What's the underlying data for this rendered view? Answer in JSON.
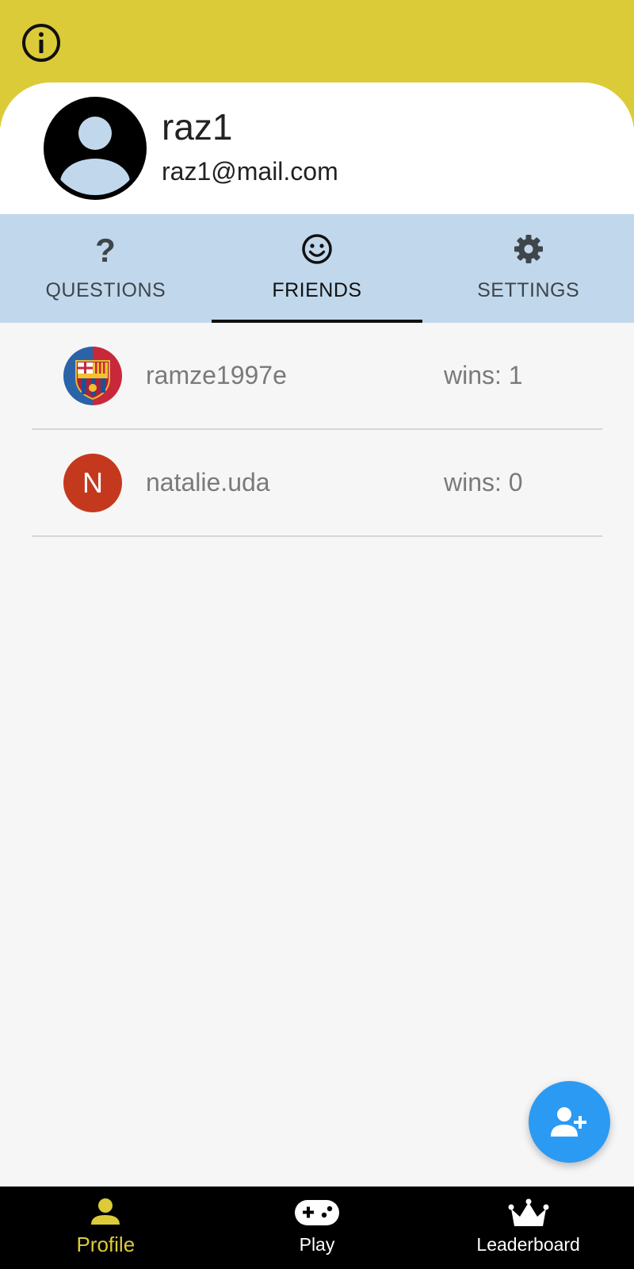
{
  "colors": {
    "accent_yellow": "#dccb39",
    "tab_background": "#c1d8ec",
    "fab_blue": "#2b9af3",
    "nav_background": "#000000"
  },
  "header": {
    "info_icon": "info-icon",
    "username": "raz1",
    "email": "raz1@mail.com"
  },
  "tabs": [
    {
      "label": "QUESTIONS",
      "icon": "question-mark-icon",
      "active": false
    },
    {
      "label": "FRIENDS",
      "icon": "smiley-face-icon",
      "active": true
    },
    {
      "label": "SETTINGS",
      "icon": "gear-icon",
      "active": false
    }
  ],
  "friends": [
    {
      "name": "ramze1997e",
      "wins": "wins: 1",
      "avatar": "fc-barcelona-crest-avatar"
    },
    {
      "name": "natalie.uda",
      "wins": "wins: 0",
      "avatar_letter": "N"
    }
  ],
  "fab": {
    "icon": "add-person-icon"
  },
  "bottom_nav": [
    {
      "label": "Profile",
      "icon": "person-icon",
      "active": true
    },
    {
      "label": "Play",
      "icon": "gamepad-icon",
      "active": false
    },
    {
      "label": "Leaderboard",
      "icon": "crown-icon",
      "active": false
    }
  ]
}
